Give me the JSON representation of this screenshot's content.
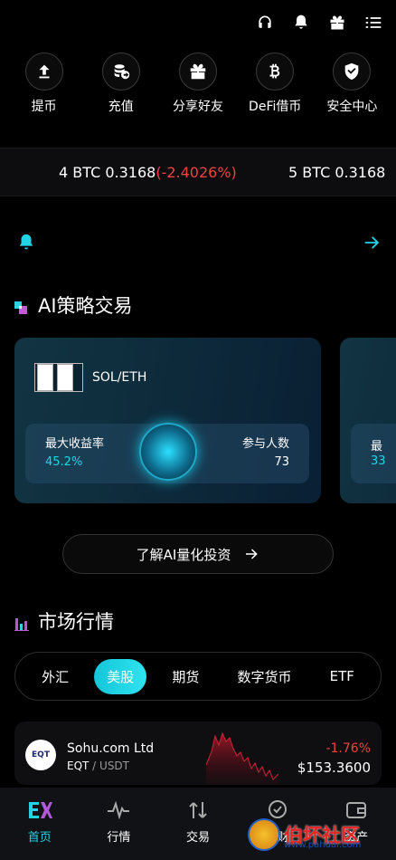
{
  "topbar": {
    "icons": [
      "headset-icon",
      "bell-icon",
      "gift-icon",
      "menu-icon"
    ]
  },
  "actions": [
    {
      "label": "提币",
      "icon": "withdraw-icon"
    },
    {
      "label": "充值",
      "icon": "deposit-icon"
    },
    {
      "label": "分享好友",
      "icon": "gift-icon"
    },
    {
      "label": "DeFi借币",
      "icon": "bitcoin-icon"
    },
    {
      "label": "安全中心",
      "icon": "shield-check-icon"
    }
  ],
  "ticker": {
    "item1_main": "4 BTC 0.3168",
    "item1_change": "(-2.4026%)",
    "item2_main": "5 BTC 0.3168"
  },
  "ai_section": {
    "title": "AI策略交易",
    "card": {
      "pair": "SOL/ETH",
      "max_yield_label": "最大收益率",
      "max_yield_value": "45.2%",
      "participants_label": "参与人数",
      "participants_value": "73"
    },
    "card2": {
      "label_partial": "最",
      "value_partial": "33"
    },
    "learn_button": "了解AI量化投资"
  },
  "market_section": {
    "title": "市场行情",
    "tabs": [
      "外汇",
      "美股",
      "期货",
      "数字货币",
      "ETF"
    ],
    "active_tab": "美股",
    "rows": [
      {
        "name": "Sohu.com Ltd",
        "symbol": "EQT",
        "quote": "USDT",
        "change": "-1.76%",
        "price": "$153.3600",
        "logo_text": "EQT"
      }
    ]
  },
  "bottom_nav": [
    {
      "label": "首页",
      "icon": "home-logo-icon",
      "active": true
    },
    {
      "label": "行情",
      "icon": "pulse-icon",
      "active": false
    },
    {
      "label": "交易",
      "icon": "swap-icon",
      "active": false
    },
    {
      "label": "理财",
      "icon": "finance-icon",
      "active": false
    },
    {
      "label": "资产",
      "icon": "wallet-icon",
      "active": false
    }
  ],
  "watermark": {
    "text": "伯坏社区",
    "url": "www.pahuai.com"
  },
  "colors": {
    "accent": "#22d3e6",
    "negative": "#f0433f",
    "background": "#000000"
  }
}
